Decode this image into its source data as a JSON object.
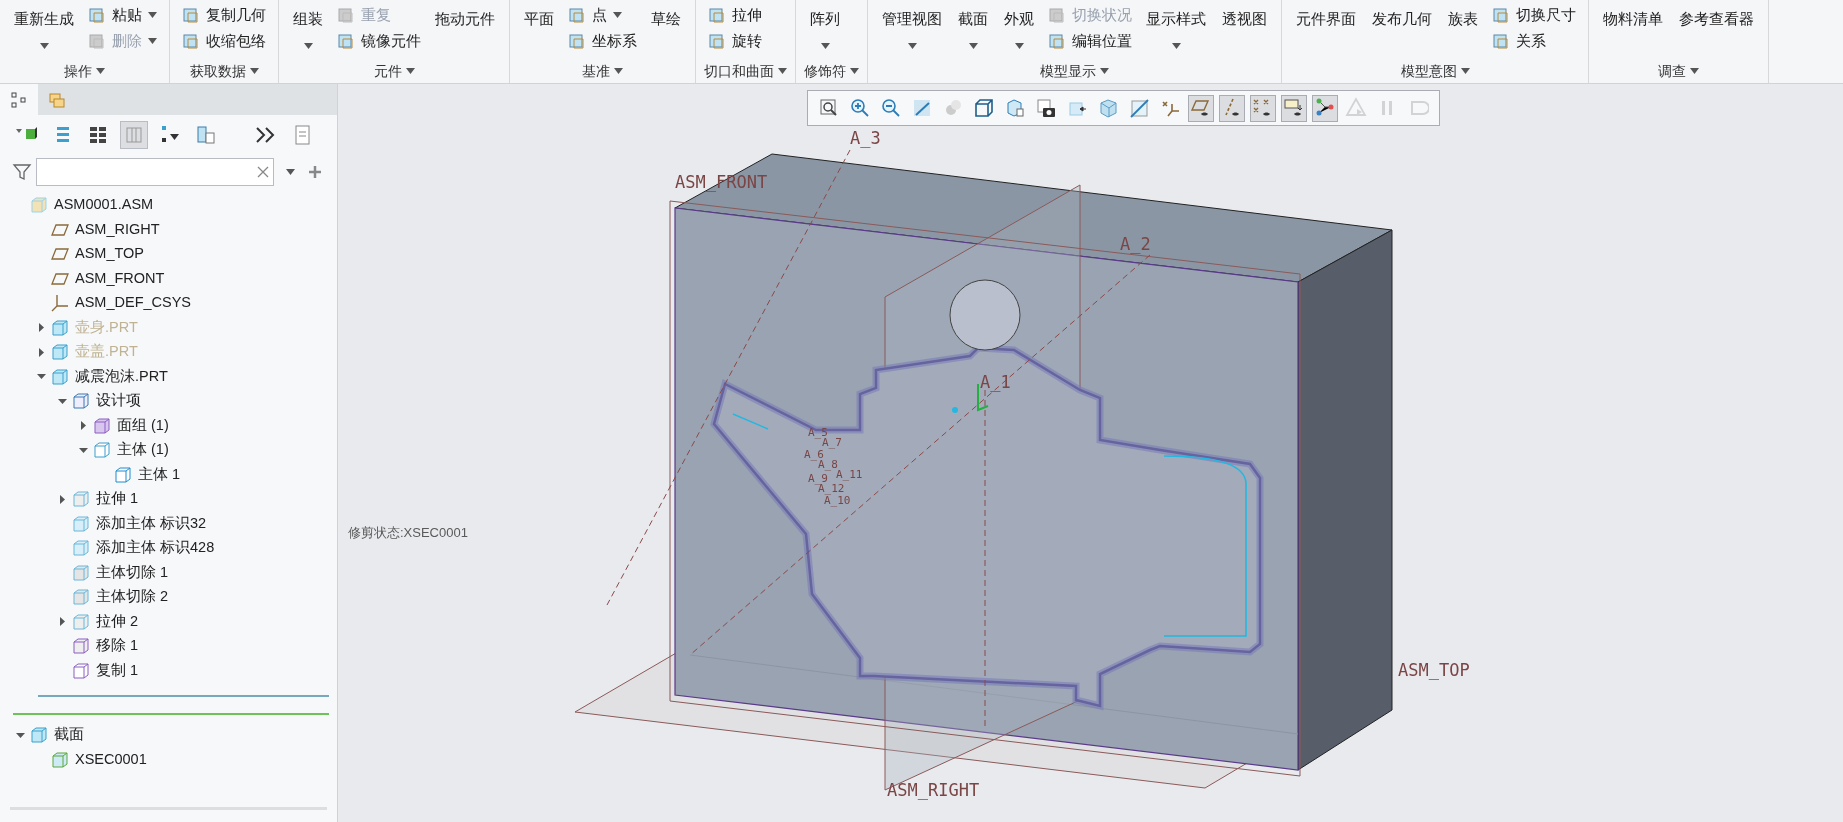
{
  "ribbon": {
    "groups": [
      {
        "label": "操作",
        "items": [
          {
            "label": "重新生成",
            "kind": "big",
            "caret": true,
            "disabled": false
          },
          {
            "label": "粘贴",
            "kind": "small",
            "caret": true,
            "disabled": false
          },
          {
            "label": "删除",
            "kind": "small",
            "caret": true,
            "disabled": true
          }
        ]
      },
      {
        "label": "获取数据",
        "items": [
          {
            "label": "复制几何",
            "kind": "small",
            "caret": false,
            "disabled": false
          },
          {
            "label": "收缩包络",
            "kind": "small",
            "caret": false,
            "disabled": false
          }
        ]
      },
      {
        "label": "元件",
        "items": [
          {
            "label": "组装",
            "kind": "big",
            "caret": true,
            "disabled": false
          },
          {
            "label": "重复",
            "kind": "small",
            "caret": false,
            "disabled": true
          },
          {
            "label": "镜像元件",
            "kind": "small",
            "caret": false,
            "disabled": false
          },
          {
            "label": "拖动元件",
            "kind": "big",
            "caret": false,
            "disabled": false
          }
        ]
      },
      {
        "label": "基准",
        "items": [
          {
            "label": "平面",
            "kind": "big",
            "caret": false,
            "disabled": false
          },
          {
            "label": "点",
            "kind": "small",
            "caret": true,
            "disabled": false
          },
          {
            "label": "坐标系",
            "kind": "small",
            "caret": false,
            "disabled": false
          },
          {
            "label": "草绘",
            "kind": "big",
            "caret": false,
            "disabled": false
          }
        ]
      },
      {
        "label": "切口和曲面",
        "items": [
          {
            "label": "拉伸",
            "kind": "small",
            "caret": false,
            "disabled": false
          },
          {
            "label": "旋转",
            "kind": "small",
            "caret": false,
            "disabled": false
          }
        ]
      },
      {
        "label": "修饰符",
        "items": [
          {
            "label": "阵列",
            "kind": "big",
            "caret": true,
            "disabled": false
          }
        ]
      },
      {
        "label": "模型显示",
        "items": [
          {
            "label": "管理视图",
            "kind": "big",
            "caret": true,
            "disabled": false
          },
          {
            "label": "截面",
            "kind": "big",
            "caret": true,
            "disabled": false
          },
          {
            "label": "外观",
            "kind": "big",
            "caret": true,
            "disabled": false
          },
          {
            "label": "切换状况",
            "kind": "small",
            "caret": false,
            "disabled": true
          },
          {
            "label": "编辑位置",
            "kind": "small",
            "caret": false,
            "disabled": false
          },
          {
            "label": "显示样式",
            "kind": "big",
            "caret": true,
            "disabled": false
          },
          {
            "label": "透视图",
            "kind": "big",
            "caret": false,
            "disabled": false
          }
        ]
      },
      {
        "label": "模型意图",
        "items": [
          {
            "label": "元件界面",
            "kind": "big",
            "caret": false,
            "disabled": false
          },
          {
            "label": "发布几何",
            "kind": "big",
            "caret": false,
            "disabled": false
          },
          {
            "label": "族表",
            "kind": "big",
            "caret": false,
            "disabled": false
          },
          {
            "label": "切换尺寸",
            "kind": "small",
            "caret": false,
            "disabled": false
          },
          {
            "label": "关系",
            "kind": "small",
            "caret": false,
            "disabled": false
          }
        ]
      },
      {
        "label": "调查",
        "items": [
          {
            "label": "物料清单",
            "kind": "big",
            "caret": false,
            "disabled": false
          },
          {
            "label": "参考查看器",
            "kind": "big",
            "caret": false,
            "disabled": false
          }
        ]
      }
    ]
  },
  "panel": {
    "tabs": [
      {
        "kind": "tree",
        "selected": true
      },
      {
        "kind": "folders",
        "selected": false
      }
    ],
    "toolbar": [
      {
        "kind": "show",
        "selected": false
      },
      {
        "kind": "tree-columns",
        "selected": false
      },
      {
        "kind": "expand",
        "selected": false
      },
      {
        "kind": "columns",
        "selected": true
      },
      {
        "kind": "filter",
        "selected": false
      },
      {
        "kind": "settings",
        "selected": false
      },
      {
        "kind": "more",
        "selected": false
      },
      {
        "kind": "notes",
        "selected": false
      }
    ],
    "tree": [
      {
        "label": "ASM0001.ASM",
        "kind": "asm",
        "dimmed": false,
        "children": [
          {
            "label": "ASM_RIGHT",
            "kind": "plane",
            "dimmed": false
          },
          {
            "label": "ASM_TOP",
            "kind": "plane",
            "dimmed": false
          },
          {
            "label": "ASM_FRONT",
            "kind": "plane",
            "dimmed": false
          },
          {
            "label": "ASM_DEF_CSYS",
            "kind": "csys",
            "dimmed": false
          },
          {
            "label": "壶身.PRT",
            "kind": "part",
            "dimmed": true,
            "expanded": false
          },
          {
            "label": "壶盖.PRT",
            "kind": "part",
            "dimmed": true,
            "expanded": false
          },
          {
            "label": "减震泡沫.PRT",
            "kind": "part",
            "dimmed": false,
            "expanded": true,
            "children": [
              {
                "label": "设计项",
                "kind": "design",
                "dimmed": false,
                "expanded": true,
                "children": [
                  {
                    "label": "面组 (1)",
                    "kind": "quilt",
                    "dimmed": false,
                    "expanded": false
                  },
                  {
                    "label": "主体 (1)",
                    "kind": "bodies",
                    "dimmed": false,
                    "expanded": true,
                    "children": [
                      {
                        "label": "主体 1",
                        "kind": "body",
                        "dimmed": false
                      }
                    ]
                  }
                ]
              },
              {
                "label": "拉伸 1",
                "kind": "extrude",
                "dimmed": false,
                "expanded": false
              },
              {
                "label": "添加主体 标识32",
                "kind": "add-body",
                "dimmed": false
              },
              {
                "label": "添加主体 标识428",
                "kind": "add-body",
                "dimmed": false
              },
              {
                "label": "主体切除 1",
                "kind": "body-cut",
                "dimmed": false
              },
              {
                "label": "主体切除 2",
                "kind": "body-cut",
                "dimmed": false
              },
              {
                "label": "拉伸 2",
                "kind": "extrude",
                "dimmed": false,
                "expanded": false
              },
              {
                "label": "移除 1",
                "kind": "remove",
                "dimmed": false
              },
              {
                "label": "复制 1",
                "kind": "copy",
                "dimmed": false
              }
            ]
          }
        ]
      }
    ],
    "sections": [
      {
        "label": "截面",
        "kind": "section",
        "dimmed": false,
        "expanded": true,
        "children": [
          {
            "label": "XSEC0001",
            "kind": "xsec",
            "dimmed": false
          }
        ]
      }
    ]
  },
  "view_toolbar": [
    {
      "kind": "refit",
      "selected": false,
      "disabled": false
    },
    {
      "kind": "zoom-in",
      "selected": false,
      "disabled": false
    },
    {
      "kind": "zoom-out",
      "selected": false,
      "disabled": false
    },
    {
      "kind": "repaint",
      "selected": false,
      "disabled": false
    },
    {
      "kind": "spheres",
      "selected": false,
      "disabled": false
    },
    {
      "kind": "cube",
      "selected": false,
      "disabled": false
    },
    {
      "kind": "cube-sheet",
      "selected": false,
      "disabled": false
    },
    {
      "kind": "camera",
      "selected": false,
      "disabled": false
    },
    {
      "kind": "cube-arrow",
      "selected": false,
      "disabled": false
    },
    {
      "kind": "cube-cut",
      "selected": false,
      "disabled": false
    },
    {
      "kind": "slash",
      "selected": false,
      "disabled": false
    },
    {
      "kind": "csys",
      "selected": false,
      "disabled": false
    },
    {
      "kind": "plane-eye",
      "selected": true,
      "disabled": false
    },
    {
      "kind": "axis-eye",
      "selected": true,
      "disabled": false
    },
    {
      "kind": "point-eye",
      "selected": true,
      "disabled": false
    },
    {
      "kind": "note-eye",
      "selected": true,
      "disabled": false
    },
    {
      "kind": "nodes",
      "selected": true,
      "disabled": false
    },
    {
      "kind": "play",
      "selected": false,
      "disabled": true
    },
    {
      "kind": "pause",
      "selected": false,
      "disabled": true
    },
    {
      "kind": "record",
      "selected": false,
      "disabled": true
    }
  ],
  "viewport": {
    "axis_labels": [
      "A_3",
      "A_2",
      "A_1"
    ],
    "plane_labels": [
      "ASM_FRONT",
      "ASM_TOP",
      "ASM_RIGHT"
    ],
    "feature_labels": [
      "A_5",
      "A_7",
      "A_6",
      "A_8",
      "A_11",
      "A_9",
      "A_12",
      "A_10"
    ],
    "section_state": "修剪状态:XSEC0001"
  }
}
